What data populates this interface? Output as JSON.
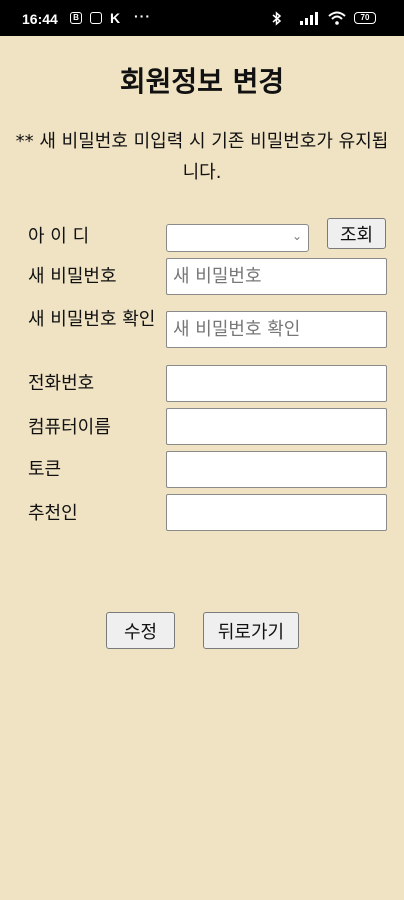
{
  "status_bar": {
    "time": "16:44",
    "notif_icon_1": "B",
    "notif_icon_3": "K",
    "more": "···",
    "battery": "70",
    "icons": [
      "bluetooth-icon",
      "signal-icon",
      "wifi-icon",
      "battery-icon"
    ]
  },
  "page": {
    "title": "회원정보 변경",
    "notice": "** 새 비밀번호 미입력 시 기존 비밀번호가 유지됩니다."
  },
  "form": {
    "id": {
      "label": "아 이 디",
      "value": ""
    },
    "lookup_button": "조회",
    "new_password": {
      "label": "새 비밀번호",
      "placeholder": "새 비밀번호"
    },
    "confirm_password": {
      "label": "새 비밀번호 확인",
      "placeholder": "새 비밀번호 확인"
    },
    "phone": {
      "label": "전화번호",
      "value": ""
    },
    "computer_name": {
      "label": "컴퓨터이름",
      "value": ""
    },
    "token": {
      "label": "토큰",
      "value": ""
    },
    "referrer": {
      "label": "추천인",
      "value": ""
    }
  },
  "actions": {
    "submit": "수정",
    "back": "뒤로가기"
  },
  "colors": {
    "background": "#efe3c4",
    "status_bar": "#000000"
  }
}
